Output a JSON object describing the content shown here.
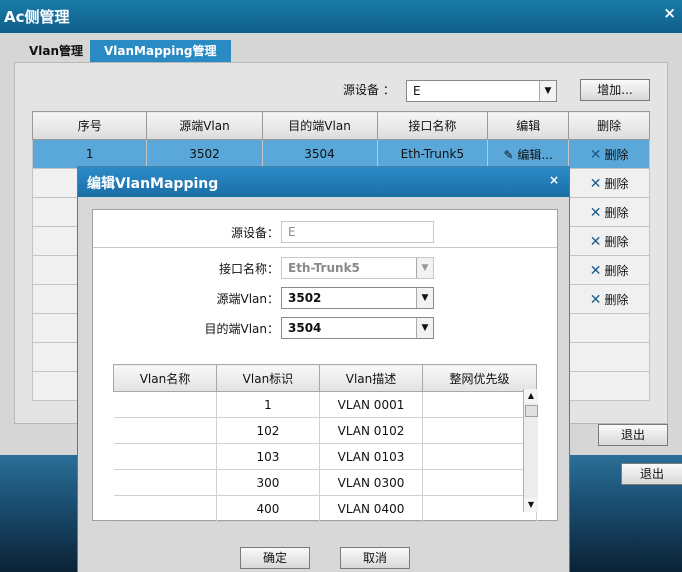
{
  "window": {
    "title": "Ac侧管理",
    "close": "×"
  },
  "tabs": [
    {
      "label": "Vlan管理"
    },
    {
      "label": "VlanMapping管理"
    }
  ],
  "toolbar": {
    "source_device_label": "源设备 ：",
    "source_device_value": "E",
    "add_label": "增加..."
  },
  "main_table": {
    "headers": [
      "序号",
      "源端Vlan",
      "目的端Vlan",
      "接口名称",
      "编辑",
      "删除"
    ],
    "rows": [
      {
        "index": "1",
        "src_vlan": "3502",
        "dst_vlan": "3504",
        "iface": "Eth-Trunk5",
        "edit": "编辑...",
        "delete": "删除"
      }
    ],
    "delete_label": "删除"
  },
  "panel_exit_label": "退出",
  "outer_exit_label": "退出",
  "dialog": {
    "title": "编辑VlanMapping",
    "close": "×",
    "source_device_label": "源设备：",
    "source_device_value": "E",
    "iface_label": "接口名称：",
    "iface_value": "Eth-Trunk5",
    "src_vlan_label": "源端Vlan：",
    "src_vlan_value": "3502",
    "dst_vlan_label": "目的端Vlan：",
    "dst_vlan_value": "3504",
    "table_headers": [
      "Vlan名称",
      "Vlan标识",
      "Vlan描述",
      "整网优先级"
    ],
    "table_rows": [
      {
        "name": "",
        "id": "1",
        "desc": "VLAN 0001",
        "prio": ""
      },
      {
        "name": "",
        "id": "102",
        "desc": "VLAN 0102",
        "prio": ""
      },
      {
        "name": "",
        "id": "103",
        "desc": "VLAN 0103",
        "prio": ""
      },
      {
        "name": "",
        "id": "300",
        "desc": "VLAN 0300",
        "prio": ""
      },
      {
        "name": "",
        "id": "400",
        "desc": "VLAN 0400",
        "prio": ""
      }
    ],
    "ok_label": "确定",
    "cancel_label": "取消"
  },
  "colors": {
    "accent": "#2a8ac4",
    "selected_row": "#5aa7d9",
    "title_bar": "#1a7ba8"
  }
}
